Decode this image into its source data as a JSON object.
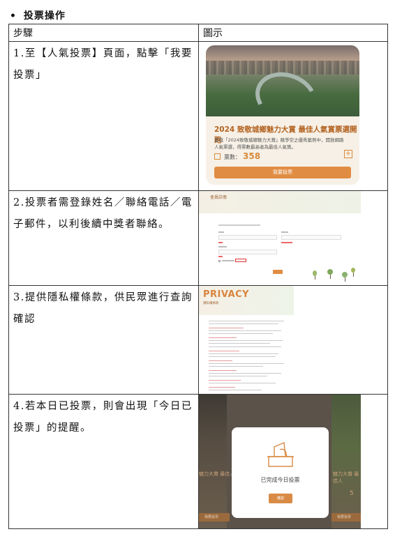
{
  "section": {
    "bullet": "•",
    "title": "投票操作"
  },
  "table": {
    "headers": [
      "步驟",
      "圖示"
    ],
    "rows": [
      {
        "step": "1.至【人氣投票】頁面，點擊「我要投票」"
      },
      {
        "step": "2.投票者需登錄姓名／聯絡電話／電子郵件，以利後續中獎者聯絡。"
      },
      {
        "step": "3.提供隱私權條款，供民眾進行查詢確認"
      },
      {
        "step": "4.若本日已投票，則會出現「今日已投票」的提醒。"
      }
    ]
  },
  "shot1": {
    "title": "2024 致敬城鄉魅力大賞 最佳人氣賞票選開跑",
    "desc": "參與「2024致敬城鄉魅力大賞」競爭空之優秀案例中，開放網路人氣票選，得票數最高者為最佳人氣賞。",
    "votes_label": "票數：",
    "votes_value": "358",
    "plus": "+",
    "button": "我要投票"
  },
  "shot2": {
    "band_title": "會員註冊"
  },
  "shot3": {
    "title": "PRIVACY",
    "subtitle": "隱私權條款"
  },
  "shot4": {
    "peek_left": "魅力大賞 最佳人",
    "peek_right": "魅力大賞 最佳人",
    "peek_left_btn": "我要投票",
    "peek_right_btn": "我要投票",
    "peek_num": "5",
    "modal_text": "已完成今日投票",
    "modal_button": "確認"
  },
  "colors": {
    "accent": "#e08d43",
    "brand_text": "#b3621f"
  }
}
